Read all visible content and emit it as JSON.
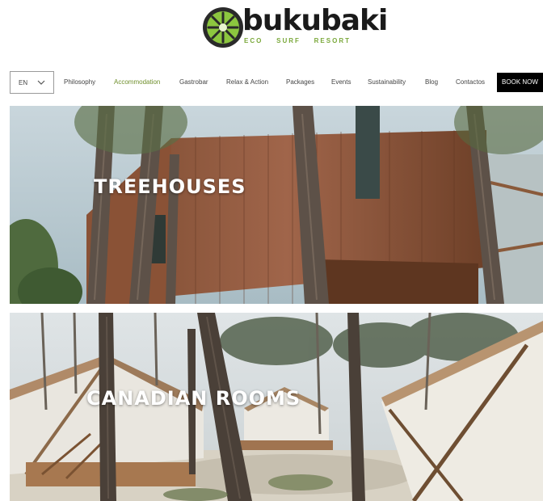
{
  "brand": {
    "name": "bukubaki",
    "tagline": [
      "ECO",
      "SURF",
      "RESORT"
    ],
    "colors": {
      "green": "#7aa83a",
      "dark": "#1a1a1a"
    }
  },
  "nav": {
    "language": "EN",
    "items": [
      {
        "label": "Philosophy",
        "active": false
      },
      {
        "label": "Accommodation",
        "active": true
      },
      {
        "label": "Gastrobar",
        "active": false
      },
      {
        "label": "Relax & Action",
        "active": false
      },
      {
        "label": "Packages",
        "active": false
      },
      {
        "label": "Events",
        "active": false
      },
      {
        "label": "Sustainability",
        "active": false
      },
      {
        "label": "Blog",
        "active": false
      },
      {
        "label": "Contactos",
        "active": false
      }
    ],
    "cta": "BOOK NOW",
    "active_color": "#6f8f2c"
  },
  "banners": [
    {
      "title": "TREEHOUSES"
    },
    {
      "title": "CANADIAN ROOMS"
    }
  ]
}
